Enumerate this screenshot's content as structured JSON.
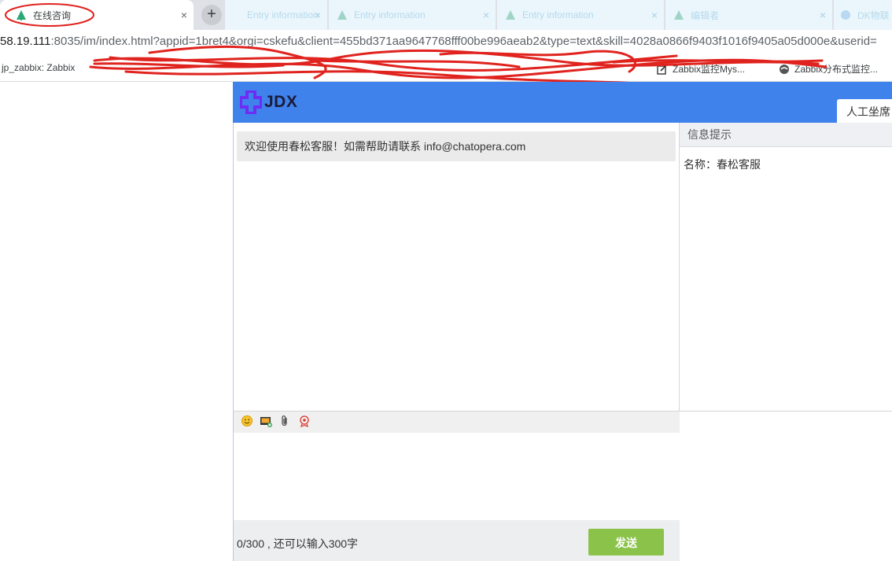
{
  "browser": {
    "tabs": [
      {
        "title": "在线咨询",
        "active": true
      },
      {
        "title": "Entry information",
        "active": false
      },
      {
        "title": "Entry information",
        "active": false
      },
      {
        "title": "Entry information",
        "active": false
      },
      {
        "title": "编辑者",
        "active": false
      },
      {
        "title": "DK物联",
        "active": false
      }
    ],
    "new_tab_label": "+",
    "close_glyph": "×",
    "url_host": "58.19.111",
    "url_rest": ":8035/im/index.html?appid=1bret4&orgi=cskefu&client=455bd371aa9647768fff00be996aeab2&type=text&skill=4028a0866f9403f1016f9405a05d000e&userid=",
    "bookmarks": [
      {
        "label": "jp_zabbix: Zabbix",
        "icon": "none"
      },
      {
        "label": "Zabbix监控Mys...",
        "icon": "edit-icon"
      },
      {
        "label": "Zabbix分布式监控...",
        "icon": "globe-icon"
      }
    ]
  },
  "app": {
    "logo_text": "JDX",
    "agent_tab": "人工坐席",
    "welcome_message": "欢迎使用春松客服！如需帮助请联系 info@chatopera.com",
    "info_panel": {
      "title": "信息提示",
      "name_line": "名称：春松客服"
    },
    "toolbar_icons": [
      "emoji-icon",
      "image-icon",
      "attachment-icon",
      "rate-icon"
    ],
    "input_value": "",
    "counter_text": "0/300 , 还可以输入300字",
    "send_label": "发送",
    "colors": {
      "header": "#3f82ec",
      "send_button": "#8bc34a",
      "logo": "#6f2cf5"
    }
  }
}
